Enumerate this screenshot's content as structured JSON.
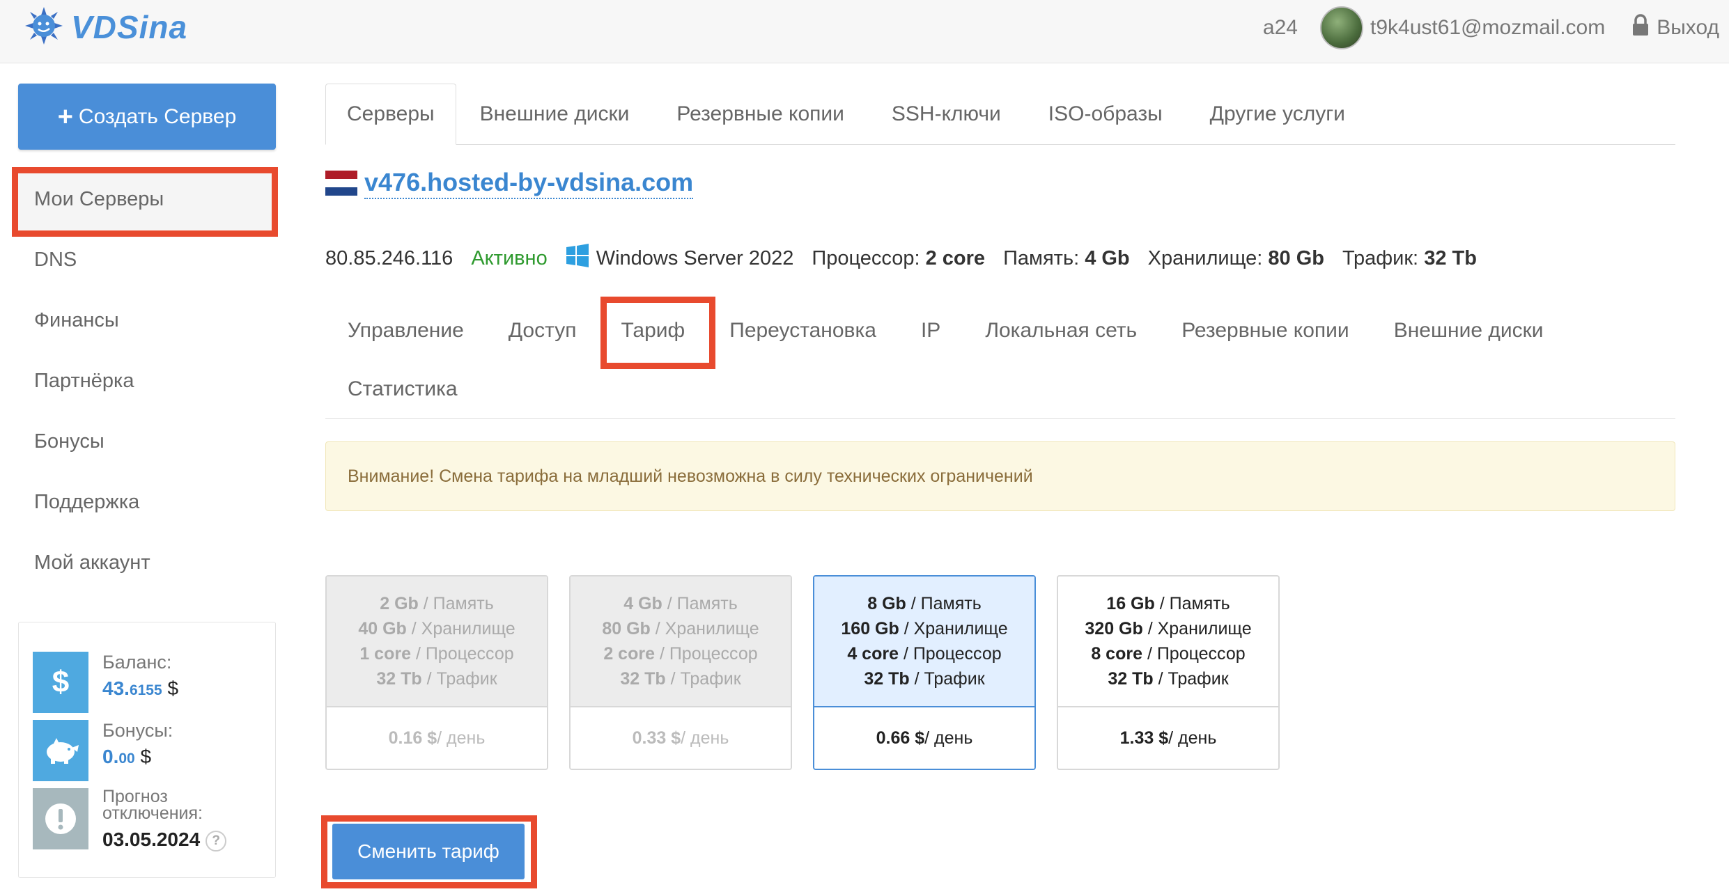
{
  "header": {
    "logo_text": "VDSina",
    "user_code": "a24",
    "email": "t9k4ust61@mozmail.com",
    "logout_label": "Выход"
  },
  "sidebar": {
    "create_button_label": "Создать Сервер",
    "items": [
      {
        "label": "Мои Серверы"
      },
      {
        "label": "DNS"
      },
      {
        "label": "Финансы"
      },
      {
        "label": "Партнёрка"
      },
      {
        "label": "Бонусы"
      },
      {
        "label": "Поддержка"
      },
      {
        "label": "Мой аккаунт"
      }
    ],
    "balance": {
      "label": "Баланс:",
      "value_main": "43.",
      "value_fraction": "6155",
      "currency": "$"
    },
    "bonuses": {
      "label": "Бонусы:",
      "value_main": "0.",
      "value_fraction": "00",
      "currency": "$"
    },
    "forecast": {
      "label_line1": "Прогноз",
      "label_line2": "отключения:",
      "date": "03.05.2024",
      "help": "?"
    }
  },
  "top_tabs": [
    {
      "label": "Серверы"
    },
    {
      "label": "Внешние диски"
    },
    {
      "label": "Резервные копии"
    },
    {
      "label": "SSH-ключи"
    },
    {
      "label": "ISO-образы"
    },
    {
      "label": "Другие услуги"
    }
  ],
  "server": {
    "hostname": "v476.hosted-by-vdsina.com",
    "ip": "80.85.246.116",
    "status": "Активно",
    "os": "Windows Server 2022",
    "cpu_label": "Процессор:",
    "cpu_value": "2 core",
    "memory_label": "Память:",
    "memory_value": "4 Gb",
    "storage_label": "Хранилище:",
    "storage_value": "80 Gb",
    "traffic_label": "Трафик:",
    "traffic_value": "32 Tb"
  },
  "sub_tabs": [
    {
      "label": "Управление"
    },
    {
      "label": "Доступ"
    },
    {
      "label": "Тариф"
    },
    {
      "label": "Переустановка"
    },
    {
      "label": "IP"
    },
    {
      "label": "Локальная сеть"
    },
    {
      "label": "Резервные копии"
    },
    {
      "label": "Внешние диски"
    },
    {
      "label": "Статистика"
    }
  ],
  "alert_text": "Внимание! Смена тарифа на младший невозможна в силу технических ограничений",
  "plans": [
    {
      "memory": "2 Gb",
      "storage": "40 Gb",
      "cpu": "1 core",
      "traffic": "32 Tb",
      "price": "0.16 $",
      "state": "disabled"
    },
    {
      "memory": "4 Gb",
      "storage": "80 Gb",
      "cpu": "2 core",
      "traffic": "32 Tb",
      "price": "0.33 $",
      "state": "disabled"
    },
    {
      "memory": "8 Gb",
      "storage": "160 Gb",
      "cpu": "4 core",
      "traffic": "32 Tb",
      "price": "0.66 $",
      "state": "current"
    },
    {
      "memory": "16 Gb",
      "storage": "320 Gb",
      "cpu": "8 core",
      "traffic": "32 Tb",
      "price": "1.33 $",
      "state": "available"
    }
  ],
  "plan_labels": {
    "memory": " / Память",
    "storage": " / Хранилище",
    "cpu": " / Процессор",
    "traffic": " / Трафик",
    "per_day": " / день"
  },
  "change_button_label": "Сменить тариф",
  "colors": {
    "accent": "#4a8ed8",
    "highlight": "#e84a2e",
    "status_active": "#2f9a2f",
    "alert_bg": "#fcf8e3"
  }
}
